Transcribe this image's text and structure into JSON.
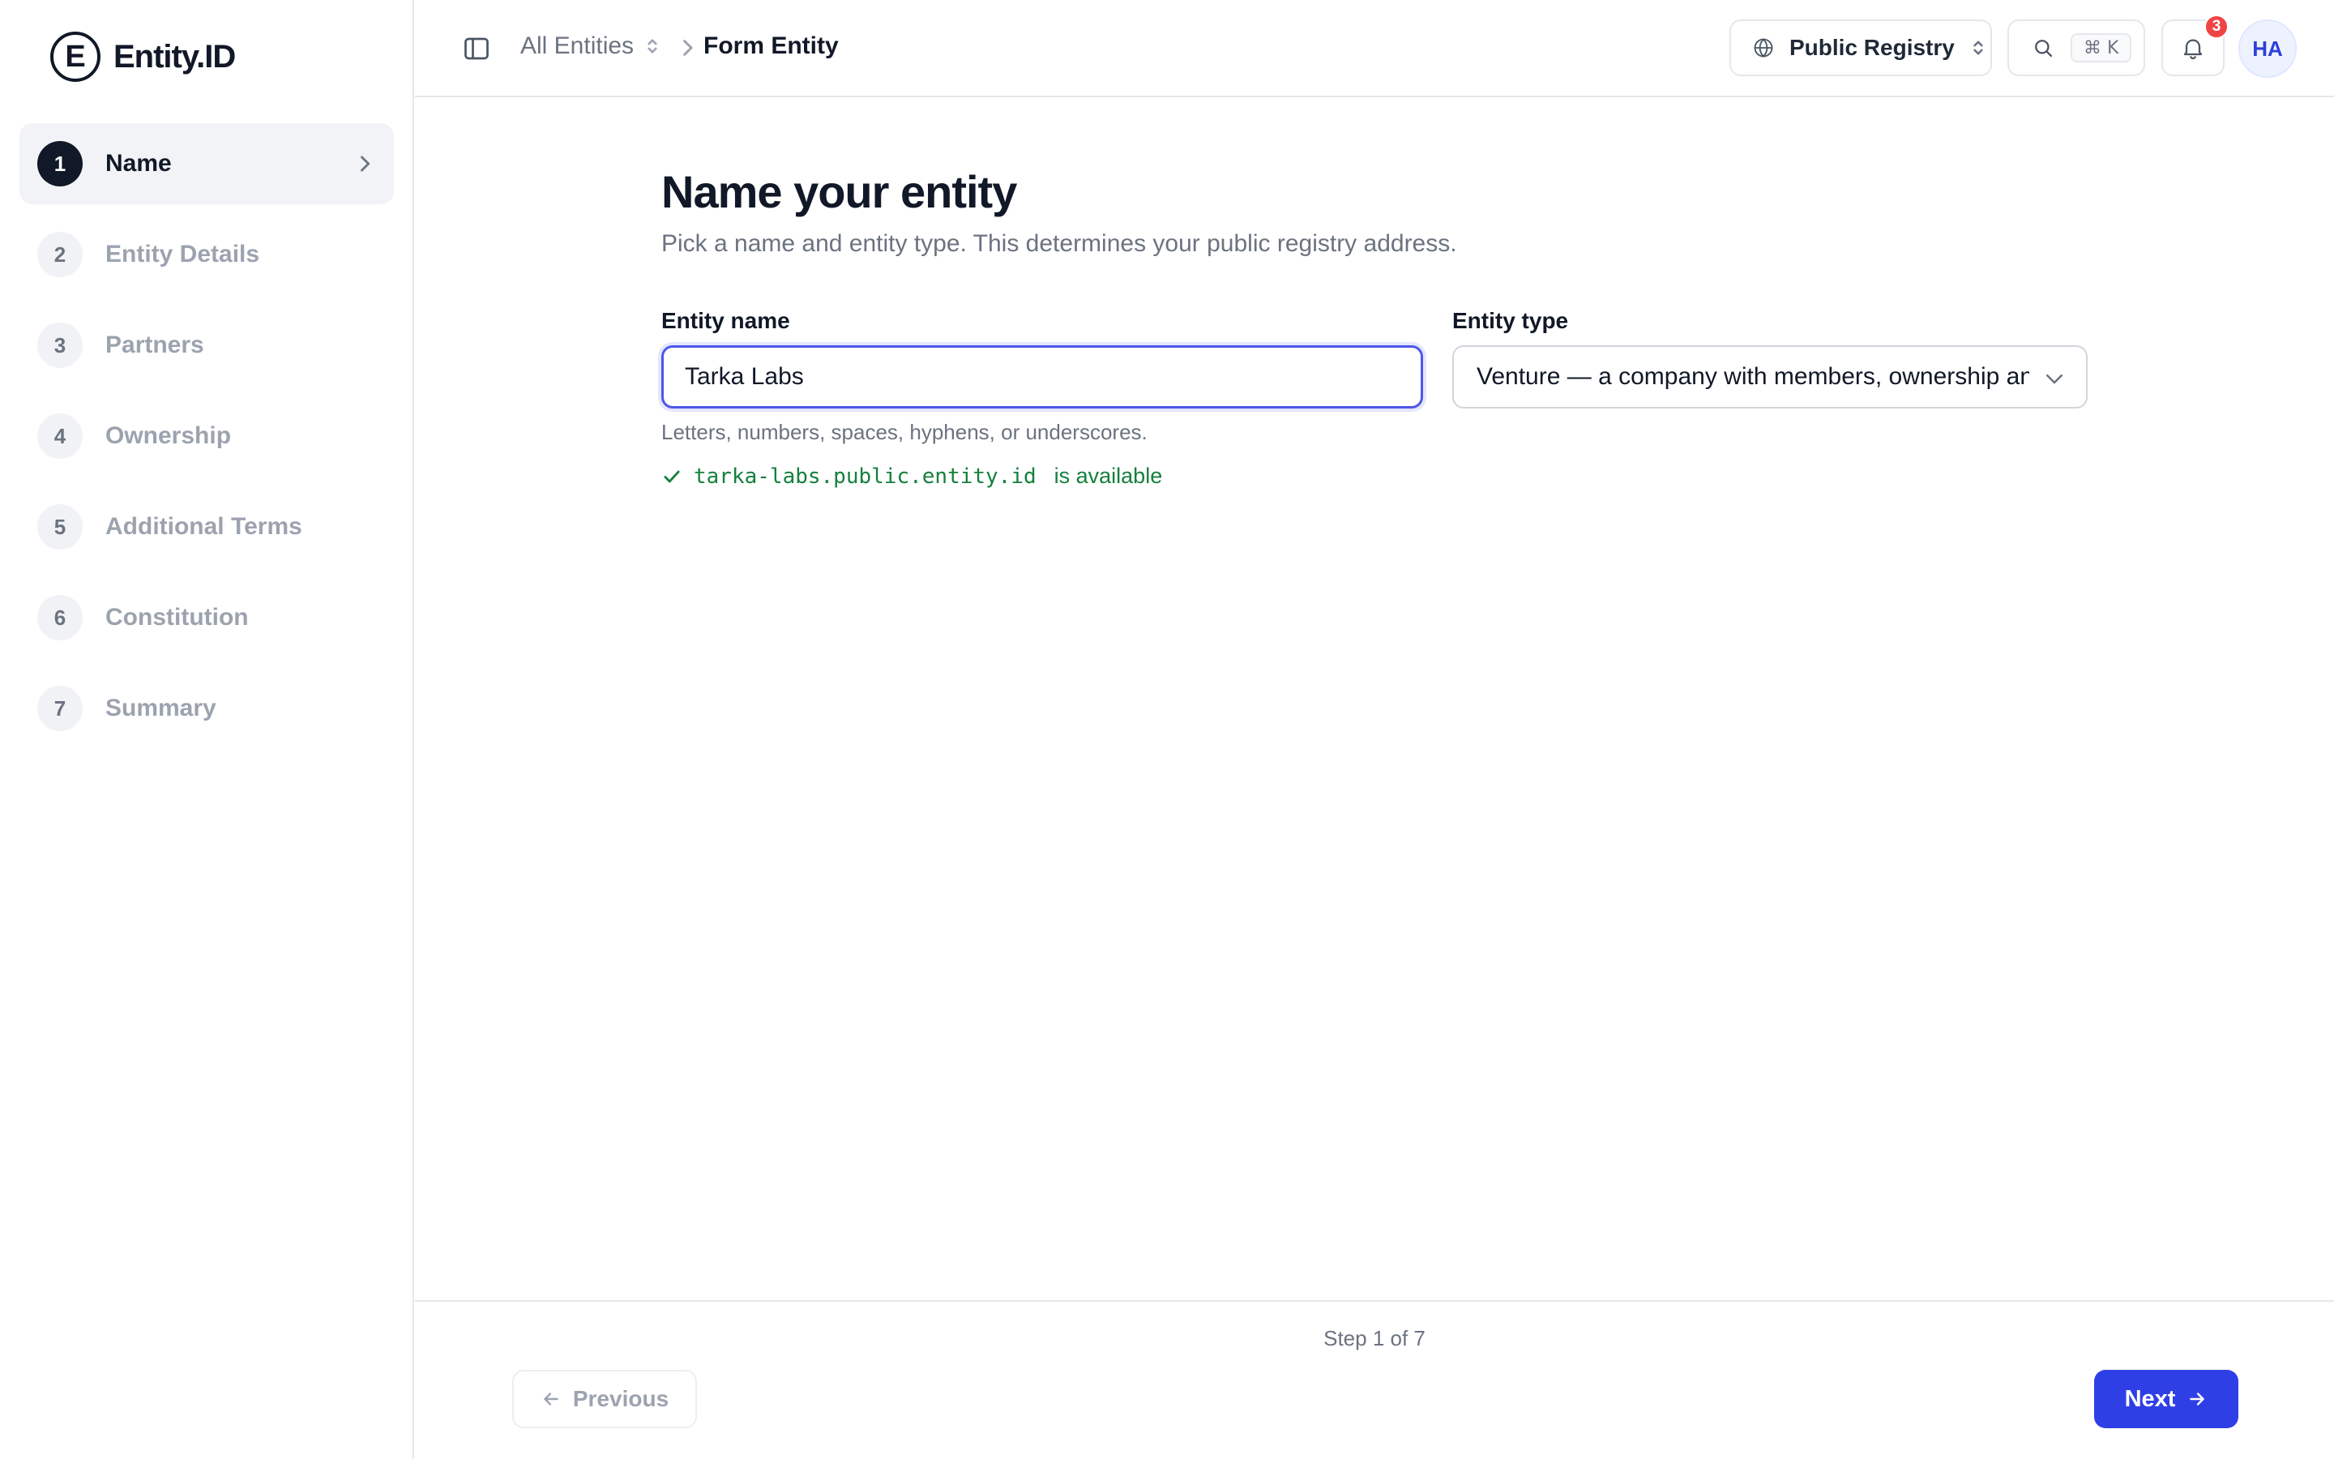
{
  "app": {
    "logo_letter": "E",
    "logo_text": "Entity.ID"
  },
  "sidebar": {
    "steps": [
      {
        "num": "1",
        "label": "Name",
        "active": true
      },
      {
        "num": "2",
        "label": "Entity Details"
      },
      {
        "num": "3",
        "label": "Partners"
      },
      {
        "num": "4",
        "label": "Ownership"
      },
      {
        "num": "5",
        "label": "Additional Terms"
      },
      {
        "num": "6",
        "label": "Constitution"
      },
      {
        "num": "7",
        "label": "Summary"
      }
    ]
  },
  "header": {
    "breadcrumb_root": "All Entities",
    "breadcrumb_current": "Form Entity",
    "registry_label": "Public Registry",
    "search_shortcut": "⌘ K",
    "notification_count": "3",
    "avatar_initials": "HA"
  },
  "form": {
    "title": "Name your entity",
    "subtitle": "Pick a name and entity type. This determines your public registry address.",
    "name_label": "Entity name",
    "name_value": "Tarka Labs",
    "type_label": "Entity type",
    "type_value": "Venture — a company with members, ownership and",
    "name_hint": "Letters, numbers, spaces, hyphens, or underscores.",
    "availability_domain": "tarka-labs.public.entity.id",
    "availability_text": "is available"
  },
  "footer": {
    "step_indicator": "Step 1 of 7",
    "previous_label": "Previous",
    "next_label": "Next"
  },
  "colors": {
    "accent": "#2f3fe6",
    "success": "#15803d",
    "badge": "#ef4444"
  }
}
